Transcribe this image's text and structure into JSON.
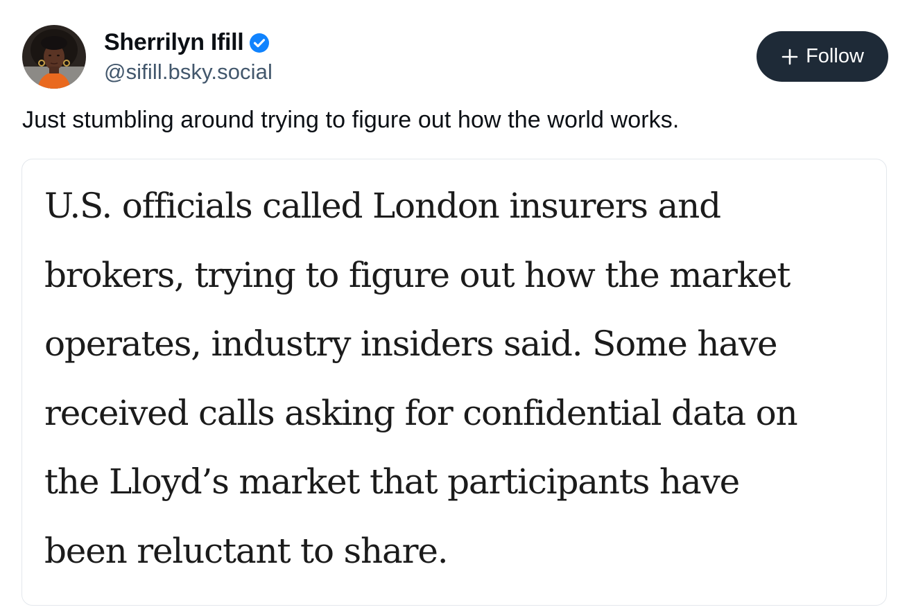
{
  "author": {
    "display_name": "Sherrilyn Ifill",
    "handle": "@sifill.bsky.social",
    "verified": true,
    "avatar_icon": "profile-photo"
  },
  "follow_button": {
    "label": "Follow",
    "icon": "plus-icon"
  },
  "post": {
    "text": "Just stumbling around trying to figure out how the world works.",
    "embed_image": {
      "lines": [
        "U.S. officials called London insurers and",
        "brokers, trying to figure out how the market",
        "operates, industry insiders said. Some have",
        "received calls asking for confidential data on",
        "the Lloyd’s market that participants have",
        "been reluctant to share."
      ]
    }
  },
  "colors": {
    "follow_bg": "#1e2a37",
    "verified_blue": "#1083fe",
    "handle_gray": "#42576c",
    "border": "#e3e7ec"
  }
}
